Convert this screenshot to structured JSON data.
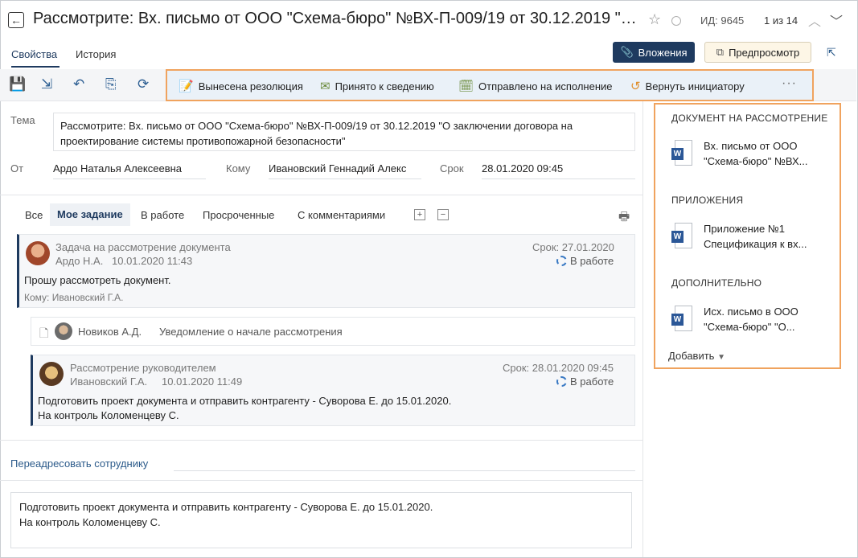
{
  "header": {
    "title": "Рассмотрите: Вх. письмо от ООО \"Схема-бюро\" №ВХ-П-009/19 от 30.12.2019 \"О заключении договора на проектирование системы противопожарной безопасности\"",
    "doc_id": "ИД: 9645",
    "pager": "1 из 14"
  },
  "tabs": {
    "properties": "Свойства",
    "history": "История",
    "attachments_button": "Вложения",
    "preview_button": "Предпросмотр"
  },
  "toolbar": {
    "actions": [
      {
        "label": "Вынесена резолюция",
        "icon": "resolution-doc-icon"
      },
      {
        "label": "Принято к сведению",
        "icon": "envelope-check-icon"
      },
      {
        "label": "Отправлено на исполнение",
        "icon": "calendar-check-icon"
      },
      {
        "label": "Вернуть инициатору",
        "icon": "return-arrow-icon"
      }
    ],
    "more": "···"
  },
  "form": {
    "subject_label": "Тема",
    "subject": "Рассмотрите: Вх. письмо от ООО \"Схема-бюро\" №ВХ-П-009/19 от 30.12.2019 \"О заключении договора на проектирование системы противопожарной безопасности\"",
    "from_label": "От",
    "from": "Ардо Наталья Алексеевна",
    "to_label": "Кому",
    "to": "Ивановский Геннадий Алекс",
    "due_label": "Срок",
    "due": "28.01.2020 09:45"
  },
  "task_filters": {
    "all": "Все",
    "mine": "Мое задание",
    "in_work": "В работе",
    "overdue": "Просроченные",
    "with_comments": "С комментариями",
    "expand": "+",
    "collapse": "−"
  },
  "tasks": [
    {
      "type": "Задача на рассмотрение документа",
      "author": "Ардо Н.А.",
      "created": "10.01.2020 11:43",
      "due": "Срок: 27.01.2020",
      "status": "В работе",
      "text": "Прошу рассмотреть документ.",
      "recipient": "Кому: Ивановский Г.А."
    },
    {
      "author": "Новиков А.Д.",
      "type": "Уведомление о начале рассмотрения"
    },
    {
      "type": "Рассмотрение руководителем",
      "author": "Ивановский Г.А.",
      "created": "10.01.2020 11:49",
      "due": "Срок: 28.01.2020 09:45",
      "status": "В работе",
      "text_line1": "Подготовить проект документа и отправить контрагенту - Суворова Е. до 15.01.2020.",
      "text_line2": "На контроль Коломенцеву С."
    }
  ],
  "bottom": {
    "redirect_link": "Переадресовать сотруднику",
    "comment": "Подготовить проект документа и отправить контрагенту - Суворова Е. до 15.01.2020.\nНа контроль Коломенцеву С."
  },
  "right_panel": {
    "doc_heading": "ДОКУМЕНТ НА РАССМОТРЕНИЕ",
    "doc_file_line1": "Вх. письмо от ООО",
    "doc_file_line2": "\"Схема-бюро\" №ВХ...",
    "attachments_heading": "ПРИЛОЖЕНИЯ",
    "attachment_line1": "Приложение №1",
    "attachment_line2": "Спецификация к вх...",
    "extra_heading": "ДОПОЛНИТЕЛЬНО",
    "extra_line1": "Исх. письмо в ООО",
    "extra_line2": "\"Схема-бюро\" \"О...",
    "file_badge": "W",
    "add": "Добавить"
  },
  "colors": {
    "accent": "#1e3a5f",
    "highlight_border": "#f0a35e",
    "link": "#2b5a8a"
  }
}
